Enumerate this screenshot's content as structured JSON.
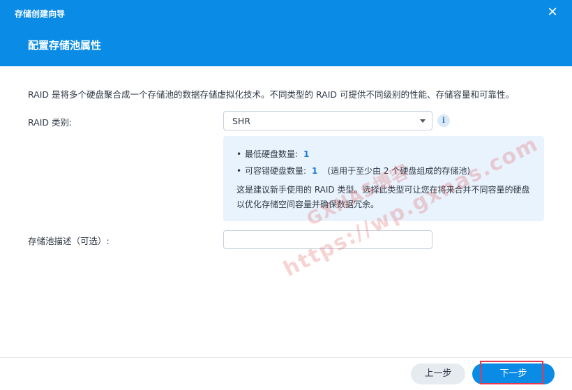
{
  "window": {
    "title": "存储创建向导",
    "close_glyph": "✕"
  },
  "header": {
    "step_title": "配置存储池属性"
  },
  "main": {
    "description": "RAID 是将多个硬盘聚合成一个存储池的数据存储虚拟化技术。不同类型的 RAID 可提供不同级别的性能、存储容量和可靠性。",
    "raid_type": {
      "label": "RAID 类别:",
      "value": "SHR",
      "info_glyph": "i"
    },
    "info_box": {
      "min_disks_label": "最低硬盘数量:",
      "min_disks_value": "1",
      "fault_tolerance_label": "可容错硬盘数量:",
      "fault_tolerance_value": "1",
      "fault_tolerance_note": "(适用于至少由 2 个硬盘组成的存储池)",
      "note": "这是建议新手使用的 RAID 类型。选择此类型可让您在将来合并不同容量的硬盘以优化存储空间容量并确保数据冗余。"
    },
    "pool_description": {
      "label": "存储池描述（可选）:",
      "value": ""
    }
  },
  "watermark": {
    "line1": "GXNAS博客",
    "line2": "https://wp.gxnas.com"
  },
  "footer": {
    "prev_label": "上一步",
    "next_label": "下一步"
  },
  "colors": {
    "brand": "#0a8ce6",
    "info_bg": "#e9f3fd",
    "highlight": "#e8374a"
  },
  "icons": [
    "close-icon",
    "chevron-down-icon",
    "info-icon"
  ]
}
